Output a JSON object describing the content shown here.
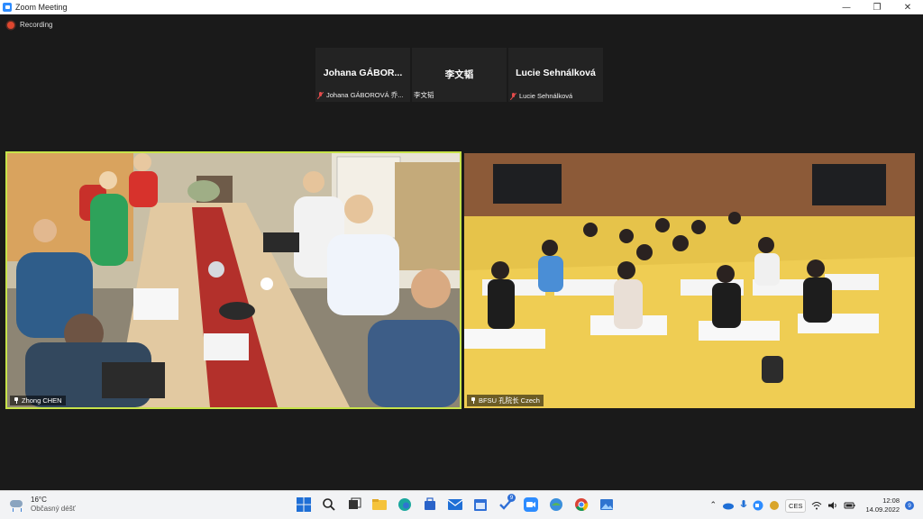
{
  "window": {
    "title": "Zoom Meeting",
    "controls": [
      "minimize",
      "maximize",
      "close"
    ]
  },
  "meeting": {
    "recording_label": "Recording",
    "thumbnails": [
      {
        "display_name": "Johana  GÁBOR...",
        "label": "Johana GÁBOROVÁ 乔...",
        "muted": true
      },
      {
        "display_name": "李文韬",
        "label": "李文韬",
        "muted": false
      },
      {
        "display_name": "Lucie Sehnálková",
        "label": "Lucie Sehnálková",
        "muted": true
      }
    ],
    "videos": [
      {
        "label": "Zhong CHEN",
        "active_speaker": true,
        "accent": "#c7e34a"
      },
      {
        "label": "BFSU 孔院长 Czech",
        "active_speaker": false
      }
    ]
  },
  "taskbar": {
    "weather": {
      "temp": "16°C",
      "desc": "Občasný déšť"
    },
    "pinned_icons": [
      "windows-start-icon",
      "search-icon",
      "task-view-icon",
      "file-explorer-icon",
      "edge-icon",
      "store-icon",
      "mail-icon",
      "calendar-icon",
      "todo-icon",
      "zoom-icon",
      "app-icon",
      "chrome-icon",
      "photos-icon"
    ],
    "todo_badge": "9",
    "tray": {
      "language": "CES",
      "time": "12:08",
      "date": "14.09.2022",
      "notifications": "9"
    }
  }
}
